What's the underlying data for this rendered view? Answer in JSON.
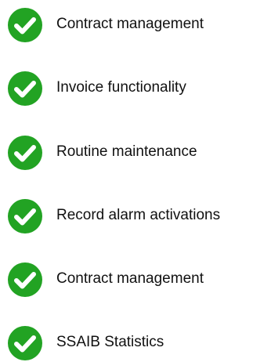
{
  "colors": {
    "check_fill": "#22a323",
    "check_mark": "#ffffff",
    "text": "#111111"
  },
  "features": [
    {
      "label": "Contract management",
      "icon": "checkmark-circle-icon"
    },
    {
      "label": "Invoice functionality",
      "icon": "checkmark-circle-icon"
    },
    {
      "label": "Routine maintenance",
      "icon": "checkmark-circle-icon"
    },
    {
      "label": "Record alarm activations",
      "icon": "checkmark-circle-icon"
    },
    {
      "label": "Contract management",
      "icon": "checkmark-circle-icon"
    },
    {
      "label": "SSAIB Statistics",
      "icon": "checkmark-circle-icon"
    }
  ]
}
